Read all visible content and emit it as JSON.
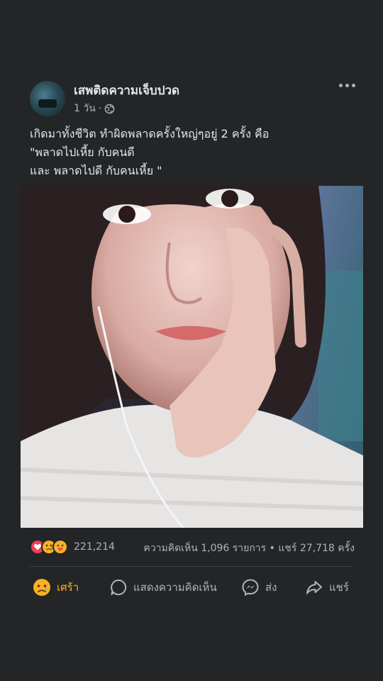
{
  "post": {
    "author": "เสพติดความเจ็บปวด",
    "time": "1 วัน",
    "separator": "·",
    "privacy_icon": "globe-icon",
    "more_icon": "more-options-icon",
    "text_lines": [
      "เกิดมาทั้งชีวิต ทำผิดพลาดครั้งใหญ่ๆอยู่ 2 ครั้ง คือ",
      "\"พลาดไปเหี้ย กับคนดี",
      "และ พลาดไปดี กับคนเหี้ย \""
    ],
    "image_icon": "photo"
  },
  "stats": {
    "reactions": [
      "love-reaction-icon",
      "sad-reaction-icon",
      "care-reaction-icon"
    ],
    "reaction_count": "221,214",
    "comments_shares": "ความคิดเห็น 1,096 รายการ • แชร์ 27,718 ครั้ง"
  },
  "actions": {
    "react_label": "เศร้า",
    "comment_label": "แสดงความคิดเห็น",
    "send_label": "ส่ง",
    "share_label": "แชร์"
  },
  "colors": {
    "background": "#242526",
    "text": "#e4e6eb",
    "secondary": "#b0b3b8",
    "sad_accent": "#f7b125",
    "love": "#f33e58"
  }
}
